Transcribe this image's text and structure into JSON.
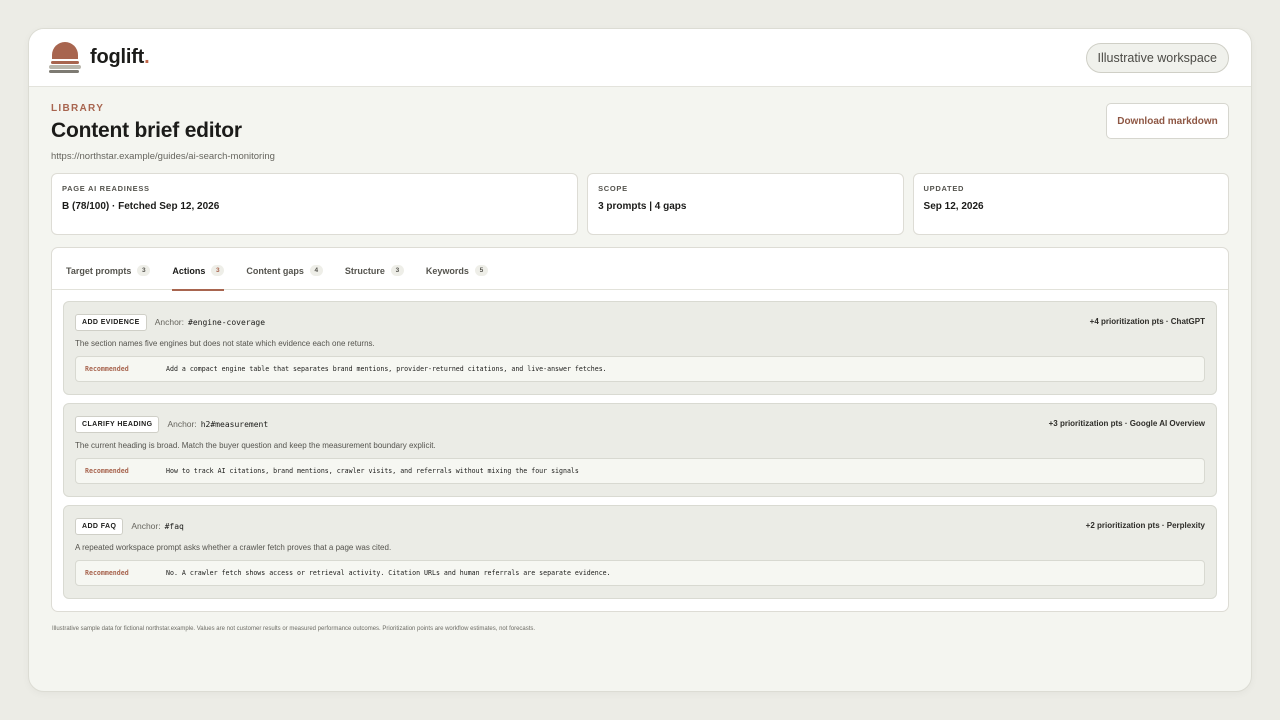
{
  "brand": {
    "name": "foglift",
    "dot": "."
  },
  "workspace_pill": "Illustrative workspace",
  "header": {
    "eyebrow": "LIBRARY",
    "title": "Content brief editor",
    "url": "https://northstar.example/guides/ai-search-monitoring",
    "download_label": "Download markdown"
  },
  "cards": [
    {
      "label": "PAGE AI READINESS",
      "value": "B (78/100) · Fetched Sep 12, 2026"
    },
    {
      "label": "SCOPE",
      "value": "3 prompts | 4 gaps"
    },
    {
      "label": "UPDATED",
      "value": "Sep 12, 2026"
    }
  ],
  "tabs": [
    {
      "label": "Target prompts",
      "count": "3"
    },
    {
      "label": "Actions",
      "count": "3",
      "active": true
    },
    {
      "label": "Content gaps",
      "count": "4"
    },
    {
      "label": "Structure",
      "count": "3"
    },
    {
      "label": "Keywords",
      "count": "5"
    }
  ],
  "actions": [
    {
      "badge": "ADD EVIDENCE",
      "anchor_label": "Anchor:",
      "anchor": "#engine-coverage",
      "meta": "+4 prioritization pts · ChatGPT",
      "desc": "The section names five engines but does not state which evidence each one returns.",
      "rec_label": "Recommended",
      "rec_text": "Add a compact engine table that separates brand mentions, provider-returned citations, and live-answer fetches."
    },
    {
      "badge": "CLARIFY HEADING",
      "anchor_label": "Anchor:",
      "anchor": "h2#measurement",
      "meta": "+3 prioritization pts · Google AI Overview",
      "desc": "The current heading is broad. Match the buyer question and keep the measurement boundary explicit.",
      "rec_label": "Recommended",
      "rec_text": "How to track AI citations, brand mentions, crawler visits, and referrals without mixing the four signals"
    },
    {
      "badge": "ADD FAQ",
      "anchor_label": "Anchor:",
      "anchor": "#faq",
      "meta": "+2 prioritization pts · Perplexity",
      "desc": "A repeated workspace prompt asks whether a crawler fetch proves that a page was cited.",
      "rec_label": "Recommended",
      "rec_text": "No. A crawler fetch shows access or retrieval activity. Citation URLs and human referrals are separate evidence."
    }
  ],
  "footnote": "Illustrative sample data for fictional northstar.example. Values are not customer results or measured performance outcomes. Prioritization points are workflow estimates, not forecasts."
}
